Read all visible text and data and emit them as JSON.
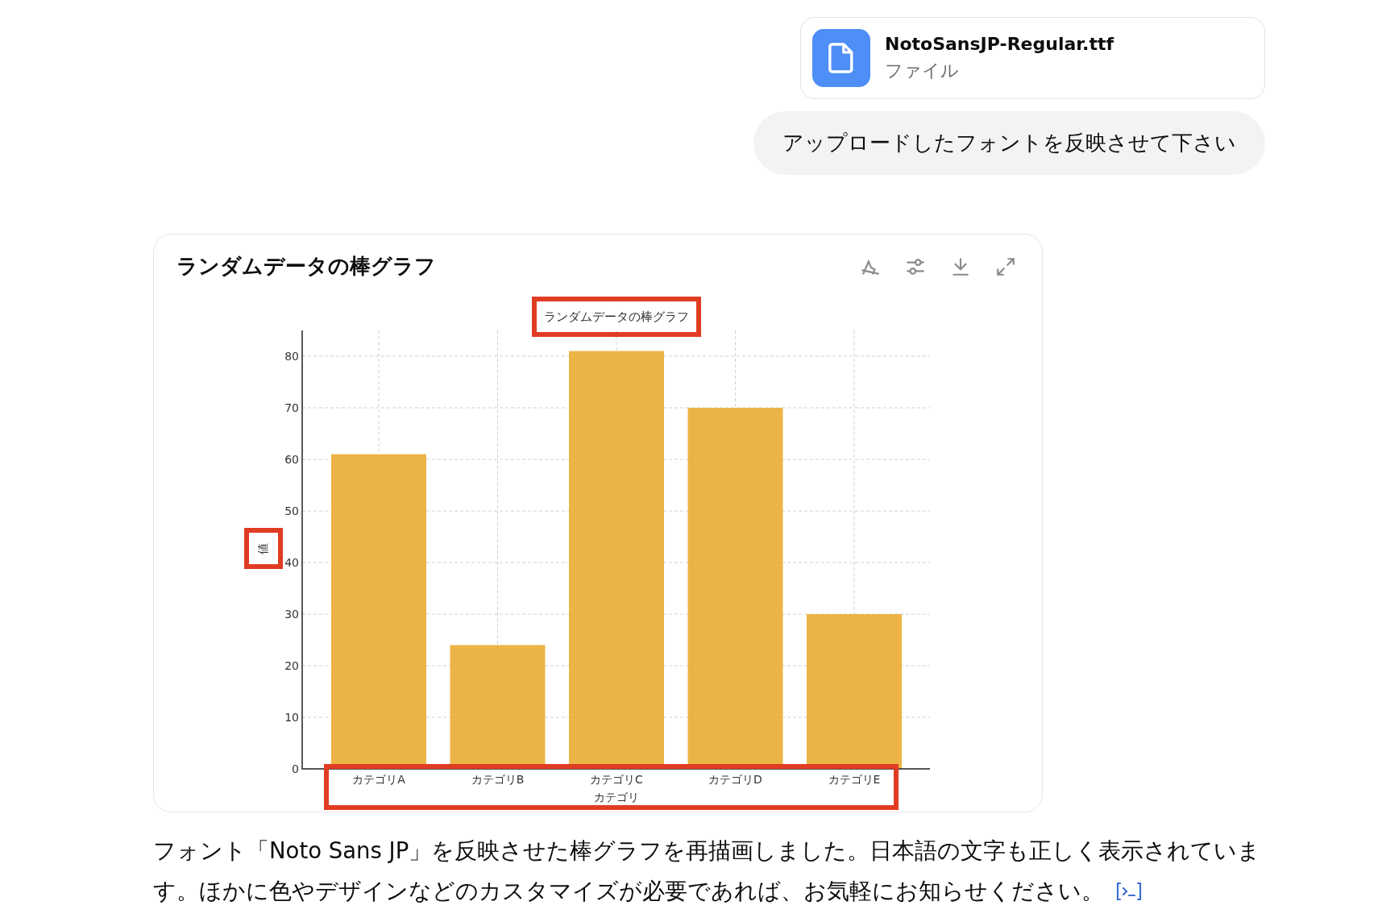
{
  "attachment": {
    "filename": "NotoSansJP-Regular.ttf",
    "type_label": "ファイル"
  },
  "user_message": "アップロードしたフォントを反映させて下さい",
  "chart_card": {
    "title": "ランダムデータの棒グラフ",
    "chart_data": {
      "type": "bar",
      "title": "ランダムデータの棒グラフ",
      "xlabel": "カテゴリ",
      "ylabel": "値",
      "categories": [
        "カテゴリA",
        "カテゴリB",
        "カテゴリC",
        "カテゴリD",
        "カテゴリE"
      ],
      "series": [
        {
          "color": "#ebb03c",
          "values": [
            61,
            24,
            81,
            70,
            30
          ]
        }
      ],
      "ylim": [
        0,
        85
      ],
      "yticks": [
        0,
        10,
        20,
        30,
        40,
        50,
        60,
        70,
        80
      ],
      "grid": true
    }
  },
  "reply_text": "フォント「Noto Sans JP」を反映させた棒グラフを再描画しました。日本語の文字も正しく表示されています。ほかに色やデザインなどのカスタマイズが必要であれば、お気軽にお知らせください。"
}
